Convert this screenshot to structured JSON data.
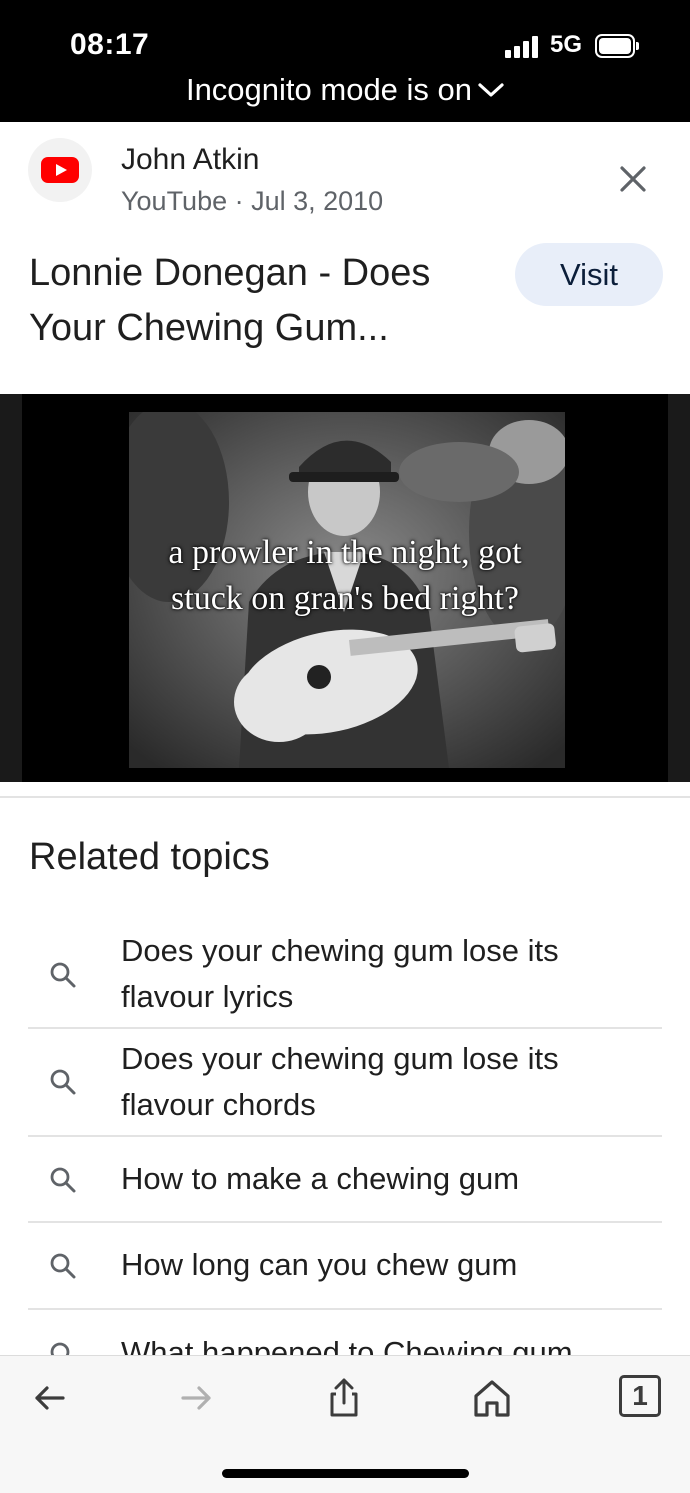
{
  "status_bar": {
    "time": "08:17",
    "network": "5G",
    "incognito_label": "Incognito mode is on",
    "icons": [
      "signal-icon",
      "battery-icon",
      "chevron-down-icon"
    ]
  },
  "result": {
    "author": "John Atkin",
    "source_and_date": "YouTube · Jul 3, 2010",
    "title": "Lonnie Donegan - Does Your Chewing Gum...",
    "visit_label": "Visit",
    "video_caption_line1": "a prowler in the night, got",
    "video_caption_line2": "stuck on gran's bed right?",
    "icons": [
      "youtube-logo-icon",
      "close-icon"
    ]
  },
  "related": {
    "heading": "Related topics",
    "items": [
      "Does your chewing gum lose its flavour lyrics",
      "Does your chewing gum lose its flavour chords",
      "How to make a chewing gum",
      "How long can you chew gum",
      "What happened to Chewing gum"
    ]
  },
  "toolbar": {
    "icons": [
      "back-arrow-icon",
      "forward-arrow-icon",
      "share-icon",
      "home-icon",
      "tabs-icon"
    ],
    "tab_count": "1"
  },
  "colors": {
    "youtube_red": "#ff0000",
    "visit_button_bg": "#e8eef9",
    "divider": "#e3e3e3"
  }
}
